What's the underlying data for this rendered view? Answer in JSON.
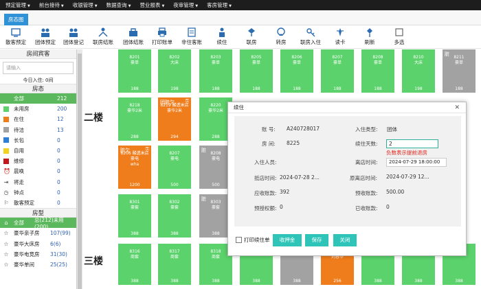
{
  "menu": [
    "预定管理",
    "前台接待",
    "收银管理",
    "数据查询",
    "营业报表",
    "夜审管理",
    "客房管理"
  ],
  "tab": "房态图",
  "toolbar": [
    "散客预定",
    "团体预定",
    "团体登记",
    "联房结账",
    "团体结账",
    "打印账单",
    "非住客账",
    "续住",
    "联房",
    "转房",
    "联房入住",
    "读卡",
    "刷新",
    "多选"
  ],
  "sidebar": {
    "title": "房间宾客",
    "search_placeholder": "请输入",
    "today": "今日入住: 0间",
    "status_title": "房态",
    "status": [
      {
        "label": "全部",
        "count": "212",
        "color": "#5cb85c"
      },
      {
        "label": "未用房",
        "count": "200",
        "color": "#5bd26b"
      },
      {
        "label": "在住",
        "count": "12",
        "color": "#f07d1c"
      },
      {
        "label": "待洁",
        "count": "13",
        "color": "#a2a2a2"
      },
      {
        "label": "长包",
        "count": "0",
        "color": "#2d7fd8"
      },
      {
        "label": "自用",
        "count": "0",
        "color": "#f2d31f"
      },
      {
        "label": "维修",
        "count": "0",
        "color": "#c5161c"
      },
      {
        "label": "晨唤",
        "count": "0",
        "icon": "alarm-icon"
      },
      {
        "label": "将走",
        "count": "0",
        "icon": "walk-icon"
      },
      {
        "label": "钟点",
        "count": "0",
        "icon": "clock-icon"
      },
      {
        "label": "散客预定",
        "count": "0",
        "icon": "flag-icon"
      }
    ],
    "types_title": "房型",
    "types": [
      {
        "label": "全部",
        "count": "总(212)未用(200)"
      },
      {
        "label": "豪华亲子房",
        "count": "107(99)"
      },
      {
        "label": "豪华大床房",
        "count": "6(6)"
      },
      {
        "label": "豪华电竞房",
        "count": "31(30)"
      },
      {
        "label": "豪华单间",
        "count": "25(25)"
      }
    ]
  },
  "floors": [
    "二楼",
    "三楼"
  ],
  "rooms": [
    {
      "no": "8201",
      "type": "豪单",
      "price": "188",
      "state": "g"
    },
    {
      "no": "8202",
      "type": "大床",
      "price": "198",
      "state": "g"
    },
    {
      "no": "8203",
      "type": "豪单",
      "price": "188",
      "state": "g"
    },
    {
      "no": "8205",
      "type": "豪单",
      "price": "188",
      "state": "g"
    },
    {
      "no": "8206",
      "type": "豪单",
      "price": "188",
      "state": "g"
    },
    {
      "no": "8207",
      "type": "豪单",
      "price": "188",
      "state": "g"
    },
    {
      "no": "8208",
      "type": "豪单",
      "price": "188",
      "state": "g"
    },
    {
      "no": "8210",
      "type": "大床",
      "price": "198",
      "state": "g"
    },
    {
      "no": "8211",
      "type": "豪单",
      "price": "188",
      "state": "gr",
      "tag": "脏"
    },
    {
      "no": "8218",
      "type": "豪华2米",
      "price": "288",
      "state": "g"
    },
    {
      "no": "8219 酸透米店",
      "type": "豪华2米",
      "price": "294",
      "state": "o",
      "tag": "团脏欠"
    },
    {
      "no": "8220",
      "type": "豪华2米",
      "price": "288",
      "state": "g"
    },
    {
      "no": "8206 酸透米店",
      "type": "豪电",
      "sub": "wha",
      "price": "1200",
      "state": "o",
      "tag": "脏欠"
    },
    {
      "no": "8207",
      "type": "豪电",
      "price": "500",
      "state": "g"
    },
    {
      "no": "8208",
      "type": "豪电",
      "price": "500",
      "state": "gr",
      "tag": "脏"
    },
    {
      "no": "8301",
      "type": "豪套",
      "price": "388",
      "state": "g"
    },
    {
      "no": "8302",
      "type": "豪套",
      "price": "388",
      "state": "g"
    },
    {
      "no": "8303",
      "type": "豪套",
      "price": "388",
      "state": "gr",
      "tag": "脏"
    },
    {
      "no": "8316",
      "type": "商套",
      "price": "388",
      "state": "g"
    },
    {
      "no": "8317",
      "type": "商套",
      "price": "388",
      "state": "g"
    },
    {
      "no": "8318",
      "type": "商套",
      "price": "388",
      "state": "g"
    },
    {
      "no": "",
      "type": "商套",
      "price": "388",
      "state": "g"
    },
    {
      "no": "",
      "type": "商套",
      "price": "388",
      "state": "gr"
    },
    {
      "no": "",
      "type": "商套",
      "sub": "刘春华",
      "price": "256",
      "state": "o"
    },
    {
      "no": "",
      "type": "商套",
      "price": "388",
      "state": "g"
    },
    {
      "no": "",
      "type": "商套",
      "price": "388",
      "state": "g"
    },
    {
      "no": "",
      "type": "商套",
      "price": "388",
      "state": "g"
    },
    {
      "no": "",
      "type": "商套",
      "price": "388",
      "state": "g"
    }
  ],
  "dialog": {
    "title": "续住",
    "account_label": "账 号:",
    "account": "A240728017",
    "checkin_type_label": "入住类型:",
    "checkin_type": "团体",
    "room_label": "房 间:",
    "room": "8225",
    "days_label": "续住天数:",
    "days": "2",
    "warning": "负数表示提前退房",
    "guests_label": "入住人员:",
    "leave_label": "离店时间:",
    "leave": "2024-07-29 18:00:00",
    "arrive_label": "抵店时间:",
    "arrive": "2024-07-28 2...",
    "orig_leave_label": "原离店时间:",
    "orig_leave": "2024-07-29 12...",
    "due_label": "应收账款:",
    "due": "392",
    "prepaid_label": "预收账款:",
    "prepaid": "500.00",
    "preauth_label": "预授权额:",
    "preauth": "0",
    "received_label": "已收账款:",
    "received": "0",
    "print_label": "打印续住单",
    "btn_deposit": "收押金",
    "btn_save": "保存",
    "btn_close": "关闭"
  }
}
